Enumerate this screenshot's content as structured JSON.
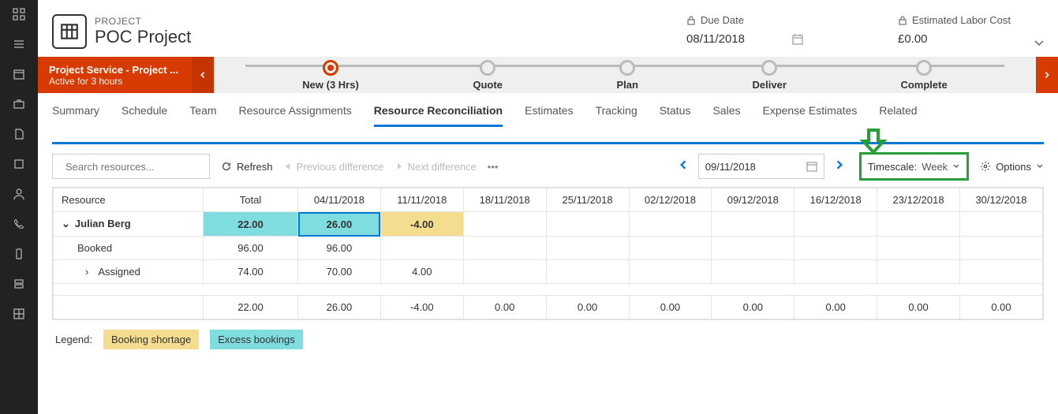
{
  "header": {
    "project_label": "PROJECT",
    "project_name": "POC Project",
    "due_date_label": "Due Date",
    "due_date_value": "08/11/2018",
    "cost_label": "Estimated Labor Cost",
    "cost_value": "£0.00"
  },
  "stage_status": {
    "line1": "Project Service - Project ...",
    "line2": "Active for 3 hours"
  },
  "stages": [
    {
      "label": "New  (3 Hrs)",
      "active": true
    },
    {
      "label": "Quote",
      "active": false
    },
    {
      "label": "Plan",
      "active": false
    },
    {
      "label": "Deliver",
      "active": false
    },
    {
      "label": "Complete",
      "active": false
    }
  ],
  "tabs": [
    "Summary",
    "Schedule",
    "Team",
    "Resource Assignments",
    "Resource Reconciliation",
    "Estimates",
    "Tracking",
    "Status",
    "Sales",
    "Expense Estimates",
    "Related"
  ],
  "active_tab": "Resource Reconciliation",
  "toolbar": {
    "search_placeholder": "Search resources...",
    "refresh": "Refresh",
    "prev_diff": "Previous difference",
    "next_diff": "Next difference",
    "date_value": "09/11/2018",
    "timescale_label": "Timescale:",
    "timescale_value": "Week",
    "options": "Options"
  },
  "grid": {
    "resource_header": "Resource",
    "total_header": "Total",
    "date_headers": [
      "04/11/2018",
      "11/11/2018",
      "18/11/2018",
      "25/11/2018",
      "02/12/2018",
      "09/12/2018",
      "16/12/2018",
      "23/12/2018",
      "30/12/2018"
    ],
    "rows": {
      "main": {
        "name": "Julian Berg",
        "total": "22.00",
        "cells": [
          "26.00",
          "-4.00",
          "",
          "",
          "",
          "",
          "",
          "",
          ""
        ]
      },
      "booked": {
        "name": "Booked",
        "total": "96.00",
        "cells": [
          "96.00",
          "",
          "",
          "",
          "",
          "",
          "",
          "",
          ""
        ]
      },
      "assigned": {
        "name": "Assigned",
        "total": "74.00",
        "cells": [
          "70.00",
          "4.00",
          "",
          "",
          "",
          "",
          "",
          "",
          ""
        ]
      },
      "summary": {
        "total": "22.00",
        "cells": [
          "26.00",
          "-4.00",
          "0.00",
          "0.00",
          "0.00",
          "0.00",
          "0.00",
          "0.00",
          "0.00"
        ]
      }
    }
  },
  "legend": {
    "label": "Legend:",
    "shortage": "Booking shortage",
    "excess": "Excess bookings"
  }
}
